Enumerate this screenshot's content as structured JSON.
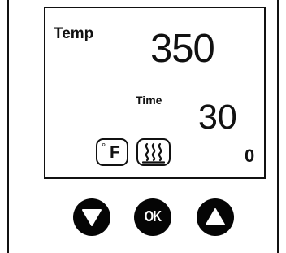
{
  "display": {
    "temp_label": "Temp",
    "temp_value": "350",
    "time_label": "Time",
    "time_value": "30",
    "counter_value": "0",
    "unit_degree_symbol": "°",
    "unit_letter": "F"
  },
  "buttons": {
    "ok_label": "OK",
    "down_icon": "triangle-down-icon",
    "up_icon": "triangle-up-icon"
  },
  "icons": {
    "heat": "heat-waves-icon"
  }
}
